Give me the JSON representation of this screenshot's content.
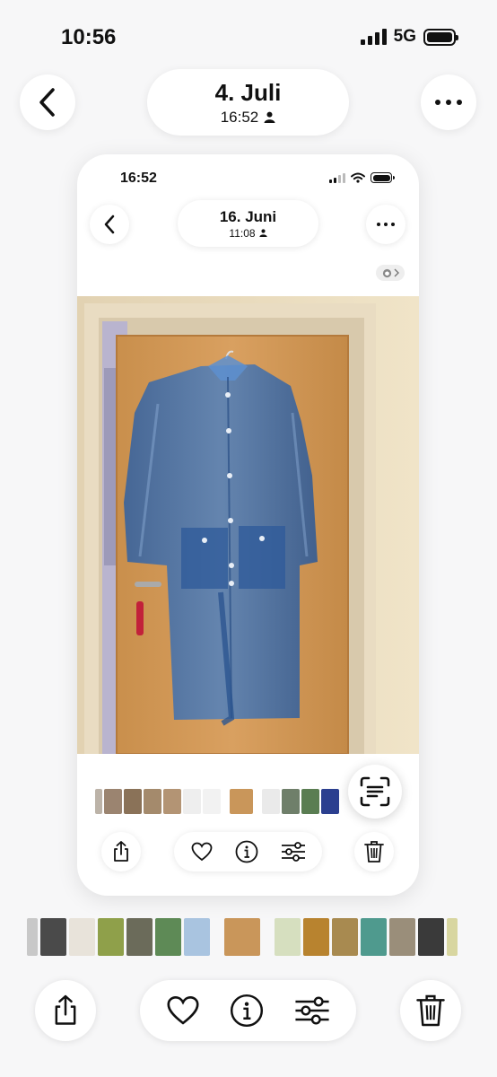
{
  "status_bar": {
    "time": "10:56",
    "network": "5G"
  },
  "header": {
    "title": "4. Juli",
    "subtitle": "16:52"
  },
  "inner_screenshot": {
    "status_bar": {
      "time": "16:52"
    },
    "header": {
      "title": "16. Juni",
      "subtitle": "11:08"
    },
    "photo": {
      "subject": "blue translucent raincoat hanging on a door"
    }
  },
  "icons": {
    "back": "chevron-left-icon",
    "more": "ellipsis-icon",
    "share": "share-icon",
    "favorite": "heart-icon",
    "info": "info-icon",
    "adjust": "sliders-icon",
    "delete": "trash-icon",
    "scan": "live-text-icon",
    "shared": "person-icon"
  },
  "colors": {
    "background": "#f7f7f8",
    "raincoat": "#3d6fb3",
    "door": "#d49a55"
  }
}
